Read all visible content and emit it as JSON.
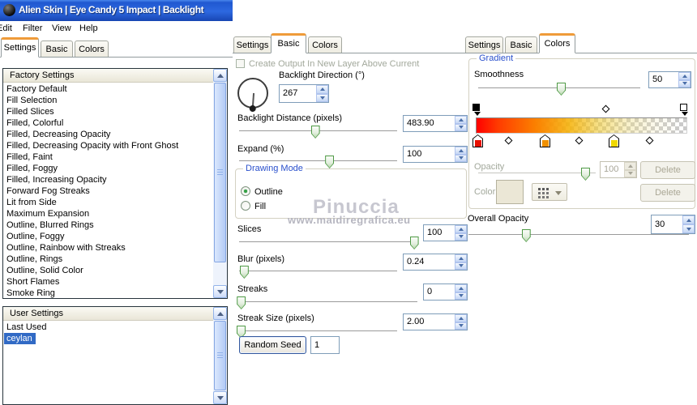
{
  "window": {
    "title": "Alien Skin | Eye Candy 5 Impact | Backlight"
  },
  "menu": {
    "items": [
      "Edit",
      "Filter",
      "View",
      "Help"
    ]
  },
  "tab_labels": [
    "Settings",
    "Basic",
    "Colors"
  ],
  "panels_selected_tab": {
    "left": "Settings",
    "middle": "Basic",
    "right": "Colors"
  },
  "left": {
    "factory": {
      "header": "Factory Settings",
      "items": [
        "Factory Default",
        "Fill Selection",
        "Filled Slices",
        "Filled, Colorful",
        "Filled, Decreasing Opacity",
        "Filled, Decreasing Opacity with Front Ghost",
        "Filled, Faint",
        "Filled, Foggy",
        "Filled, Increasing Opacity",
        "Forward Fog Streaks",
        "Lit from Side",
        "Maximum Expansion",
        "Outline, Blurred Rings",
        "Outline, Foggy",
        "Outline, Rainbow with Streaks",
        "Outline, Rings",
        "Outline, Solid Color",
        "Short Flames",
        "Smoke Ring"
      ]
    },
    "user": {
      "header": "User Settings",
      "items": [
        "Last Used",
        "ceylan"
      ],
      "selected_index": 1
    }
  },
  "basic_panel": {
    "create_output_label": "Create Output In New Layer Above Current",
    "direction": {
      "label": "Backlight Direction (°)",
      "value": "267"
    },
    "sliders": [
      {
        "label": "Backlight Distance (pixels)",
        "value": "483.90"
      },
      {
        "label": "Expand (%)",
        "value": "100"
      },
      {
        "label": "Slices",
        "value": "100"
      },
      {
        "label": "Blur (pixels)",
        "value": "0.24"
      },
      {
        "label": "Streaks",
        "value": "0"
      },
      {
        "label": "Streak Size (pixels)",
        "value": "2.00"
      }
    ],
    "drawing_mode": {
      "label": "Drawing Mode",
      "options": [
        "Outline",
        "Fill"
      ],
      "selected": "Outline"
    },
    "random_seed": {
      "button_label": "Random Seed",
      "value": "1"
    }
  },
  "colors_panel": {
    "group_label": "Gradient",
    "smoothness": {
      "label": "Smoothness",
      "value": "50"
    },
    "opacity": {
      "label": "Opacity",
      "value": "100"
    },
    "color_label": "Color",
    "delete_label": "Delete",
    "overall_opacity": {
      "label": "Overall Opacity",
      "value": "30"
    }
  },
  "watermark": {
    "line1": "Pinuccia",
    "line2": "www.maidiregrafica.eu"
  },
  "icons": {
    "app_logo": "dark-sphere-icon",
    "scroll_up": "chevron-up",
    "scroll_down": "chevron-down",
    "spinner": "triangle-up-down",
    "color_picker": "grid-swatch",
    "dropdown": "triangle-down",
    "dial": "direction-dial"
  },
  "colors": {
    "titlebar_blue": "#2d68e0",
    "tab_accent_orange": "#ef9b39",
    "selection_blue": "#316ac5",
    "group_label_blue": "#2a50cc",
    "slider_green": "#4f9a46",
    "gradient_stop_colors": [
      "#e81000",
      "#f09000",
      "#f0d800"
    ],
    "watermark_gray": "#c7c7d0"
  }
}
